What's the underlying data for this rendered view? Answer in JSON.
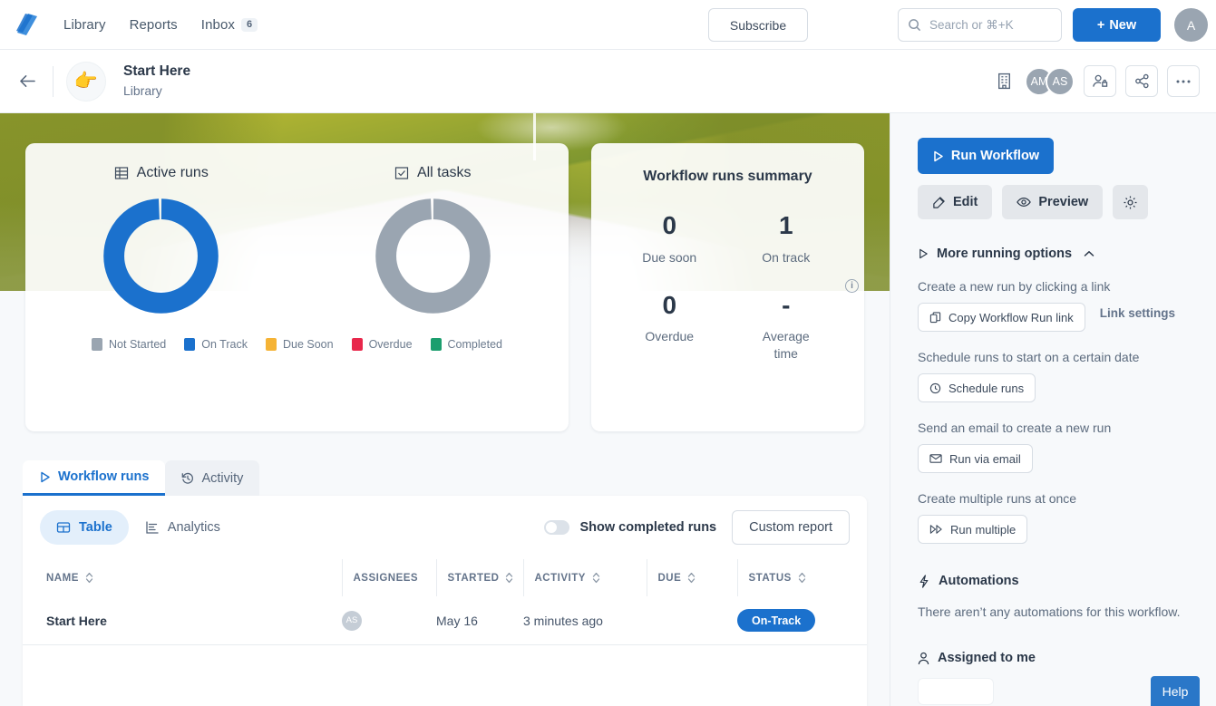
{
  "topnav": {
    "links": [
      {
        "label": "Library",
        "icon": "library-link"
      },
      {
        "label": "Reports",
        "icon": "reports-link"
      },
      {
        "label": "Inbox",
        "icon": "inbox-link",
        "badge": "6"
      }
    ],
    "subscribe_label": "Subscribe",
    "search_placeholder": "Search or ⌘+K",
    "new_label": "New",
    "new_plus": "+",
    "avatar_initial": "A"
  },
  "subheader": {
    "emoji": "👉",
    "title": "Start Here",
    "subtitle": "Library",
    "avatars": [
      "AM",
      "AS"
    ]
  },
  "charts_card": {
    "active_runs": {
      "title": "Active runs",
      "icon": "table-icon"
    },
    "all_tasks": {
      "title": "All tasks",
      "icon": "checkbox-icon"
    },
    "legend": [
      {
        "label": "Not Started",
        "color": "#9aa5b1"
      },
      {
        "label": "On Track",
        "color": "#1b71cd"
      },
      {
        "label": "Due Soon",
        "color": "#f5b335"
      },
      {
        "label": "Overdue",
        "color": "#e8274b"
      },
      {
        "label": "Completed",
        "color": "#1c9e6e"
      }
    ]
  },
  "chart_data": [
    {
      "type": "pie",
      "title": "Active runs",
      "labels": [
        "Not Started",
        "On Track",
        "Due Soon",
        "Overdue",
        "Completed"
      ],
      "values": [
        0,
        1,
        0,
        0,
        0
      ],
      "colors": [
        "#9aa5b1",
        "#1b71cd",
        "#f5b335",
        "#e8274b",
        "#1c9e6e"
      ],
      "donut": true,
      "legend_position": "bottom"
    },
    {
      "type": "pie",
      "title": "All tasks",
      "labels": [
        "Not Started",
        "On Track",
        "Due Soon",
        "Overdue",
        "Completed"
      ],
      "values": [
        1,
        0,
        0,
        0,
        0
      ],
      "colors": [
        "#9aa5b1",
        "#1b71cd",
        "#f5b335",
        "#e8274b",
        "#1c9e6e"
      ],
      "donut": true,
      "legend_position": "bottom"
    }
  ],
  "summary_card": {
    "title": "Workflow runs summary",
    "cells": [
      {
        "value": "0",
        "label": "Due soon"
      },
      {
        "value": "1",
        "label": "On track"
      },
      {
        "value": "0",
        "label": "Overdue"
      },
      {
        "value": "-",
        "label": "Average time"
      }
    ],
    "info_icon": "i"
  },
  "tabs": [
    {
      "label": "Workflow runs",
      "icon": "play-icon",
      "active": true
    },
    {
      "label": "Activity",
      "icon": "history-icon",
      "active": false
    }
  ],
  "panel_toolbar": {
    "views": [
      {
        "label": "Table",
        "icon": "table-icon",
        "active": true
      },
      {
        "label": "Analytics",
        "icon": "analytics-icon",
        "active": false
      }
    ],
    "toggle_label": "Show completed runs",
    "toggle_on": false,
    "custom_report_label": "Custom report"
  },
  "table": {
    "columns": [
      "NAME",
      "ASSIGNEES",
      "STARTED",
      "ACTIVITY",
      "DUE",
      "STATUS"
    ],
    "rows": [
      {
        "name": "Start Here",
        "assignee": "AS",
        "started": "May 16",
        "activity": "3 minutes ago",
        "due": "",
        "status": "On-Track"
      }
    ]
  },
  "sidebar": {
    "run_workflow_label": "Run Workflow",
    "edit_label": "Edit",
    "preview_label": "Preview",
    "settings_icon": "gear-icon",
    "more_options_label": "More running options",
    "groups": [
      {
        "hint": "Create a new run by clicking a link",
        "button": "Copy Workflow Run link",
        "icon": "copy-icon",
        "link": "Link settings"
      },
      {
        "hint": "Schedule runs to start on a certain date",
        "button": "Schedule runs",
        "icon": "clock-icon"
      },
      {
        "hint": "Send an email to create a new run",
        "button": "Run via email",
        "icon": "mail-icon"
      },
      {
        "hint": "Create multiple runs at once",
        "button": "Run multiple",
        "icon": "fast-forward-icon"
      }
    ],
    "automations_title": "Automations",
    "automations_empty": "There aren’t any automations for this workflow.",
    "assigned_title": "Assigned to me"
  },
  "help_label": "Help"
}
